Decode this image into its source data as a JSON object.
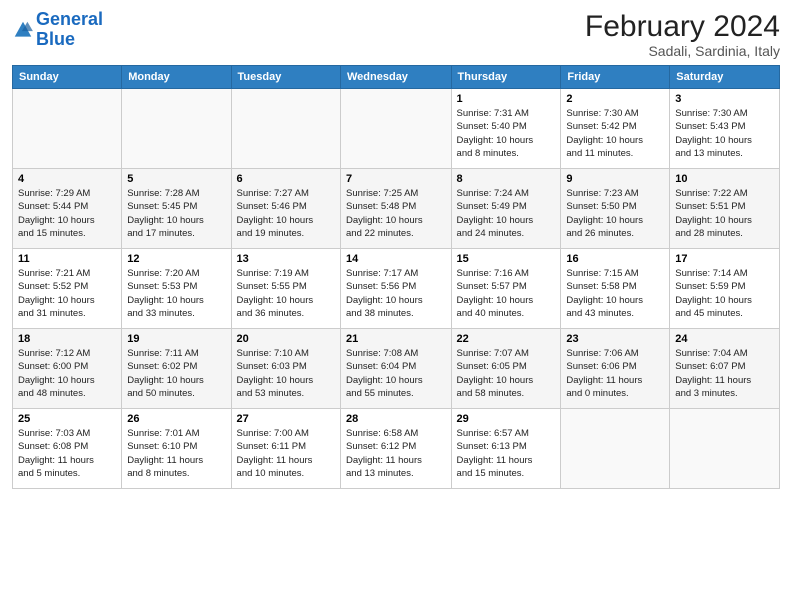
{
  "header": {
    "logo_line1": "General",
    "logo_line2": "Blue",
    "title": "February 2024",
    "subtitle": "Sadali, Sardinia, Italy"
  },
  "days_of_week": [
    "Sunday",
    "Monday",
    "Tuesday",
    "Wednesday",
    "Thursday",
    "Friday",
    "Saturday"
  ],
  "weeks": [
    [
      {
        "num": "",
        "info": ""
      },
      {
        "num": "",
        "info": ""
      },
      {
        "num": "",
        "info": ""
      },
      {
        "num": "",
        "info": ""
      },
      {
        "num": "1",
        "info": "Sunrise: 7:31 AM\nSunset: 5:40 PM\nDaylight: 10 hours\nand 8 minutes."
      },
      {
        "num": "2",
        "info": "Sunrise: 7:30 AM\nSunset: 5:42 PM\nDaylight: 10 hours\nand 11 minutes."
      },
      {
        "num": "3",
        "info": "Sunrise: 7:30 AM\nSunset: 5:43 PM\nDaylight: 10 hours\nand 13 minutes."
      }
    ],
    [
      {
        "num": "4",
        "info": "Sunrise: 7:29 AM\nSunset: 5:44 PM\nDaylight: 10 hours\nand 15 minutes."
      },
      {
        "num": "5",
        "info": "Sunrise: 7:28 AM\nSunset: 5:45 PM\nDaylight: 10 hours\nand 17 minutes."
      },
      {
        "num": "6",
        "info": "Sunrise: 7:27 AM\nSunset: 5:46 PM\nDaylight: 10 hours\nand 19 minutes."
      },
      {
        "num": "7",
        "info": "Sunrise: 7:25 AM\nSunset: 5:48 PM\nDaylight: 10 hours\nand 22 minutes."
      },
      {
        "num": "8",
        "info": "Sunrise: 7:24 AM\nSunset: 5:49 PM\nDaylight: 10 hours\nand 24 minutes."
      },
      {
        "num": "9",
        "info": "Sunrise: 7:23 AM\nSunset: 5:50 PM\nDaylight: 10 hours\nand 26 minutes."
      },
      {
        "num": "10",
        "info": "Sunrise: 7:22 AM\nSunset: 5:51 PM\nDaylight: 10 hours\nand 28 minutes."
      }
    ],
    [
      {
        "num": "11",
        "info": "Sunrise: 7:21 AM\nSunset: 5:52 PM\nDaylight: 10 hours\nand 31 minutes."
      },
      {
        "num": "12",
        "info": "Sunrise: 7:20 AM\nSunset: 5:53 PM\nDaylight: 10 hours\nand 33 minutes."
      },
      {
        "num": "13",
        "info": "Sunrise: 7:19 AM\nSunset: 5:55 PM\nDaylight: 10 hours\nand 36 minutes."
      },
      {
        "num": "14",
        "info": "Sunrise: 7:17 AM\nSunset: 5:56 PM\nDaylight: 10 hours\nand 38 minutes."
      },
      {
        "num": "15",
        "info": "Sunrise: 7:16 AM\nSunset: 5:57 PM\nDaylight: 10 hours\nand 40 minutes."
      },
      {
        "num": "16",
        "info": "Sunrise: 7:15 AM\nSunset: 5:58 PM\nDaylight: 10 hours\nand 43 minutes."
      },
      {
        "num": "17",
        "info": "Sunrise: 7:14 AM\nSunset: 5:59 PM\nDaylight: 10 hours\nand 45 minutes."
      }
    ],
    [
      {
        "num": "18",
        "info": "Sunrise: 7:12 AM\nSunset: 6:00 PM\nDaylight: 10 hours\nand 48 minutes."
      },
      {
        "num": "19",
        "info": "Sunrise: 7:11 AM\nSunset: 6:02 PM\nDaylight: 10 hours\nand 50 minutes."
      },
      {
        "num": "20",
        "info": "Sunrise: 7:10 AM\nSunset: 6:03 PM\nDaylight: 10 hours\nand 53 minutes."
      },
      {
        "num": "21",
        "info": "Sunrise: 7:08 AM\nSunset: 6:04 PM\nDaylight: 10 hours\nand 55 minutes."
      },
      {
        "num": "22",
        "info": "Sunrise: 7:07 AM\nSunset: 6:05 PM\nDaylight: 10 hours\nand 58 minutes."
      },
      {
        "num": "23",
        "info": "Sunrise: 7:06 AM\nSunset: 6:06 PM\nDaylight: 11 hours\nand 0 minutes."
      },
      {
        "num": "24",
        "info": "Sunrise: 7:04 AM\nSunset: 6:07 PM\nDaylight: 11 hours\nand 3 minutes."
      }
    ],
    [
      {
        "num": "25",
        "info": "Sunrise: 7:03 AM\nSunset: 6:08 PM\nDaylight: 11 hours\nand 5 minutes."
      },
      {
        "num": "26",
        "info": "Sunrise: 7:01 AM\nSunset: 6:10 PM\nDaylight: 11 hours\nand 8 minutes."
      },
      {
        "num": "27",
        "info": "Sunrise: 7:00 AM\nSunset: 6:11 PM\nDaylight: 11 hours\nand 10 minutes."
      },
      {
        "num": "28",
        "info": "Sunrise: 6:58 AM\nSunset: 6:12 PM\nDaylight: 11 hours\nand 13 minutes."
      },
      {
        "num": "29",
        "info": "Sunrise: 6:57 AM\nSunset: 6:13 PM\nDaylight: 11 hours\nand 15 minutes."
      },
      {
        "num": "",
        "info": ""
      },
      {
        "num": "",
        "info": ""
      }
    ]
  ]
}
